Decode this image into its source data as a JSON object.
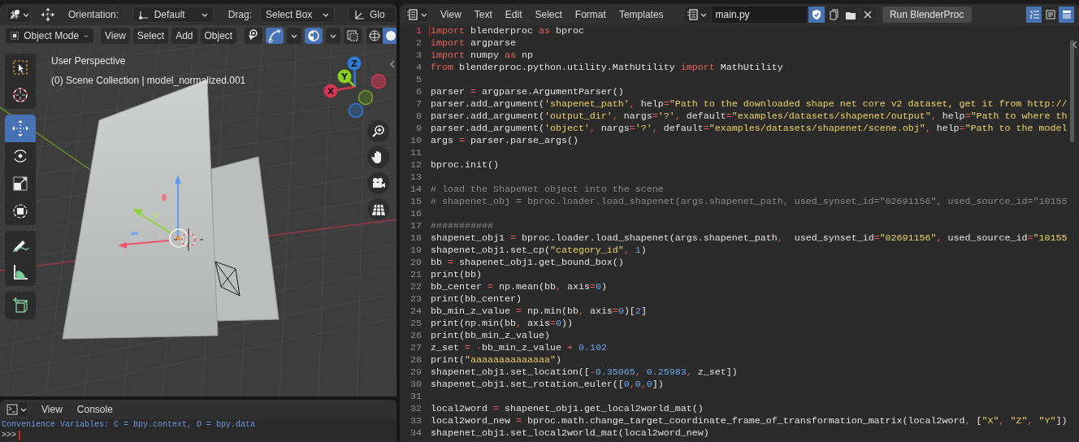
{
  "viewport": {
    "tool_header": {
      "orientation_label": "Orientation:",
      "orientation": "Default",
      "drag_label": "Drag:",
      "drag": "Select Box",
      "pivot": "Glo"
    },
    "mode": "Object Mode",
    "menus": [
      "View",
      "Select",
      "Add",
      "Object"
    ],
    "toggles": [
      {
        "on": false
      },
      {
        "on": true
      },
      {
        "on": true
      },
      {
        "on": false
      }
    ],
    "shading": [
      {
        "selected": false
      },
      {
        "selected": true
      }
    ],
    "overlay_text": [
      "User Perspective",
      "(0) Scene Collection | model_normalized.001"
    ],
    "axes": [
      "Z",
      "Y",
      "X"
    ],
    "tool_groups": [
      {
        "tools": [
          {
            "selected": false
          },
          {
            "selected": false
          }
        ]
      },
      {
        "tools": [
          {
            "selected": true
          },
          {
            "selected": false
          },
          {
            "selected": false
          },
          {
            "selected": false
          }
        ]
      },
      {
        "tools": [
          {
            "selected": false
          },
          {
            "selected": false
          }
        ]
      },
      {
        "tools": [
          {
            "selected": false
          }
        ]
      }
    ]
  },
  "console": {
    "menus": [
      "View",
      "Console"
    ],
    "lines": [
      "Convenience Variables: C = bpy.context, D = bpy.data",
      ">>>"
    ]
  },
  "text_editor": {
    "menus": [
      "View",
      "Text",
      "Edit",
      "Select",
      "Format",
      "Templates"
    ],
    "file_name": "main.py",
    "fake_user": {
      "on": true
    },
    "run_button": "Run BlenderProc",
    "view_toggles": [
      {
        "on": true
      },
      {
        "on": false
      },
      {
        "on": true
      }
    ],
    "lines": [
      {
        "number": "1",
        "current": true,
        "segments": [
          {
            "kind": "keyword",
            "text": "import"
          },
          {
            "kind": "plain",
            "text": " blenderproc "
          },
          {
            "kind": "keyword",
            "text": "as"
          },
          {
            "kind": "plain",
            "text": " bproc"
          }
        ]
      },
      {
        "number": "2",
        "current": false,
        "segments": [
          {
            "kind": "keyword",
            "text": "import"
          },
          {
            "kind": "plain",
            "text": " argparse"
          }
        ]
      },
      {
        "number": "3",
        "current": false,
        "segments": [
          {
            "kind": "keyword",
            "text": "import"
          },
          {
            "kind": "plain",
            "text": " numpy "
          },
          {
            "kind": "keyword",
            "text": "as"
          },
          {
            "kind": "plain",
            "text": " np"
          }
        ]
      },
      {
        "number": "4",
        "current": false,
        "segments": [
          {
            "kind": "keyword",
            "text": "from"
          },
          {
            "kind": "plain",
            "text": " blenderproc.python.utility.MathUtility "
          },
          {
            "kind": "keyword",
            "text": "import"
          },
          {
            "kind": "plain",
            "text": " MathUtility"
          }
        ]
      },
      {
        "number": "5",
        "current": false
      },
      {
        "number": "6",
        "current": false,
        "segments": [
          {
            "kind": "plain",
            "text": "parser "
          },
          {
            "kind": "operator",
            "text": "="
          },
          {
            "kind": "plain",
            "text": " argparse.ArgumentParser()"
          }
        ]
      },
      {
        "number": "7",
        "current": false,
        "segments": [
          {
            "kind": "plain",
            "text": "parser.add_argument("
          },
          {
            "kind": "string",
            "text": "'shapenet_path'"
          },
          {
            "kind": "operator",
            "text": ","
          },
          {
            "kind": "plain",
            "text": " help"
          },
          {
            "kind": "operator",
            "text": "="
          },
          {
            "kind": "string",
            "text": "\"Path to the downloaded shape net core v2 dataset, get it from http://"
          }
        ]
      },
      {
        "number": "8",
        "current": false,
        "segments": [
          {
            "kind": "plain",
            "text": "parser.add_argument("
          },
          {
            "kind": "string",
            "text": "'output_dir'"
          },
          {
            "kind": "operator",
            "text": ","
          },
          {
            "kind": "plain",
            "text": " nargs"
          },
          {
            "kind": "operator",
            "text": "="
          },
          {
            "kind": "string",
            "text": "'?'"
          },
          {
            "kind": "operator",
            "text": ","
          },
          {
            "kind": "plain",
            "text": " default"
          },
          {
            "kind": "operator",
            "text": "="
          },
          {
            "kind": "string",
            "text": "\"examples/datasets/shapenet/output\""
          },
          {
            "kind": "operator",
            "text": ","
          },
          {
            "kind": "plain",
            "text": " help"
          },
          {
            "kind": "operator",
            "text": "="
          },
          {
            "kind": "string",
            "text": "\"Path to where th"
          }
        ]
      },
      {
        "number": "9",
        "current": false,
        "segments": [
          {
            "kind": "plain",
            "text": "parser.add_argument("
          },
          {
            "kind": "string",
            "text": "'object'"
          },
          {
            "kind": "operator",
            "text": ","
          },
          {
            "kind": "plain",
            "text": " nargs"
          },
          {
            "kind": "operator",
            "text": "="
          },
          {
            "kind": "string",
            "text": "'?'"
          },
          {
            "kind": "operator",
            "text": ","
          },
          {
            "kind": "plain",
            "text": " default"
          },
          {
            "kind": "operator",
            "text": "="
          },
          {
            "kind": "string",
            "text": "\"examples/datasets/shapenet/scene.obj\""
          },
          {
            "kind": "operator",
            "text": ","
          },
          {
            "kind": "plain",
            "text": " help"
          },
          {
            "kind": "operator",
            "text": "="
          },
          {
            "kind": "string",
            "text": "\"Path to the model"
          }
        ]
      },
      {
        "number": "10",
        "current": false,
        "segments": [
          {
            "kind": "plain",
            "text": "args "
          },
          {
            "kind": "operator",
            "text": "="
          },
          {
            "kind": "plain",
            "text": " parser.parse_args()"
          }
        ]
      },
      {
        "number": "11",
        "current": false
      },
      {
        "number": "12",
        "current": false,
        "segments": [
          {
            "kind": "plain",
            "text": "bproc.init()"
          }
        ]
      },
      {
        "number": "13",
        "current": false
      },
      {
        "number": "14",
        "current": false,
        "segments": [
          {
            "kind": "comment",
            "text": "# load the ShapeNet object into the scene"
          }
        ]
      },
      {
        "number": "15",
        "current": false,
        "segments": [
          {
            "kind": "comment",
            "text": "# shapenet_obj = bproc.loader.load_shapenet(args.shapenet_path, used_synset_id=\"02691156\", used_source_id=\"10155"
          }
        ]
      },
      {
        "number": "16",
        "current": false
      },
      {
        "number": "17",
        "current": false,
        "segments": [
          {
            "kind": "comment",
            "text": "###########"
          }
        ]
      },
      {
        "number": "18",
        "current": false,
        "segments": [
          {
            "kind": "plain",
            "text": "shapenet_obj1 "
          },
          {
            "kind": "operator",
            "text": "="
          },
          {
            "kind": "plain",
            "text": " bproc.loader.load_shapenet(args.shapenet_path"
          },
          {
            "kind": "operator",
            "text": ","
          },
          {
            "kind": "plain",
            "text": "  used_synset_id"
          },
          {
            "kind": "operator",
            "text": "="
          },
          {
            "kind": "string",
            "text": "\"02691156\""
          },
          {
            "kind": "operator",
            "text": ","
          },
          {
            "kind": "plain",
            "text": " used_source_id"
          },
          {
            "kind": "operator",
            "text": "="
          },
          {
            "kind": "string",
            "text": "\"10155"
          }
        ]
      },
      {
        "number": "19",
        "current": false,
        "segments": [
          {
            "kind": "plain",
            "text": "shapenet_obj1.set_cp("
          },
          {
            "kind": "string",
            "text": "\"category_id\""
          },
          {
            "kind": "operator",
            "text": ", "
          },
          {
            "kind": "number",
            "text": "1"
          },
          {
            "kind": "plain",
            "text": ")"
          }
        ]
      },
      {
        "number": "20",
        "current": false,
        "segments": [
          {
            "kind": "plain",
            "text": "bb "
          },
          {
            "kind": "operator",
            "text": "="
          },
          {
            "kind": "plain",
            "text": " shapenet_obj1.get_bound_box()"
          }
        ]
      },
      {
        "number": "21",
        "current": false,
        "segments": [
          {
            "kind": "plain",
            "text": "print(bb)"
          }
        ]
      },
      {
        "number": "22",
        "current": false,
        "segments": [
          {
            "kind": "plain",
            "text": "bb_center "
          },
          {
            "kind": "operator",
            "text": "="
          },
          {
            "kind": "plain",
            "text": " np.mean(bb"
          },
          {
            "kind": "operator",
            "text": ","
          },
          {
            "kind": "plain",
            "text": " axis"
          },
          {
            "kind": "operator",
            "text": "="
          },
          {
            "kind": "number",
            "text": "0"
          },
          {
            "kind": "plain",
            "text": ")"
          }
        ]
      },
      {
        "number": "23",
        "current": false,
        "segments": [
          {
            "kind": "plain",
            "text": "print(bb_center)"
          }
        ]
      },
      {
        "number": "24",
        "current": false,
        "segments": [
          {
            "kind": "plain",
            "text": "bb_min_z_value "
          },
          {
            "kind": "operator",
            "text": "="
          },
          {
            "kind": "plain",
            "text": " np.min(bb"
          },
          {
            "kind": "operator",
            "text": ","
          },
          {
            "kind": "plain",
            "text": " axis"
          },
          {
            "kind": "operator",
            "text": "="
          },
          {
            "kind": "number",
            "text": "0"
          },
          {
            "kind": "plain",
            "text": ")["
          },
          {
            "kind": "number",
            "text": "2"
          },
          {
            "kind": "plain",
            "text": "]"
          }
        ]
      },
      {
        "number": "25",
        "current": false,
        "segments": [
          {
            "kind": "plain",
            "text": "print(np.min(bb"
          },
          {
            "kind": "operator",
            "text": ","
          },
          {
            "kind": "plain",
            "text": " axis"
          },
          {
            "kind": "operator",
            "text": "="
          },
          {
            "kind": "number",
            "text": "0"
          },
          {
            "kind": "plain",
            "text": "))"
          }
        ]
      },
      {
        "number": "26",
        "current": false,
        "segments": [
          {
            "kind": "plain",
            "text": "print(bb_min_z_value)"
          }
        ]
      },
      {
        "number": "27",
        "current": false,
        "segments": [
          {
            "kind": "plain",
            "text": "z_set "
          },
          {
            "kind": "operator",
            "text": "= -"
          },
          {
            "kind": "plain",
            "text": "bb_min_z_value "
          },
          {
            "kind": "operator",
            "text": "+ "
          },
          {
            "kind": "number",
            "text": "0.102"
          }
        ]
      },
      {
        "number": "28",
        "current": false,
        "segments": [
          {
            "kind": "plain",
            "text": "print("
          },
          {
            "kind": "string",
            "text": "\"aaaaaaaaaaaaaa\""
          },
          {
            "kind": "plain",
            "text": ")"
          }
        ]
      },
      {
        "number": "29",
        "current": false,
        "segments": [
          {
            "kind": "plain",
            "text": "shapenet_obj1.set_location(["
          },
          {
            "kind": "operator",
            "text": "-"
          },
          {
            "kind": "number",
            "text": "0.35065"
          },
          {
            "kind": "operator",
            "text": ", "
          },
          {
            "kind": "number",
            "text": "0.25983"
          },
          {
            "kind": "operator",
            "text": ","
          },
          {
            "kind": "plain",
            "text": " z_set])"
          }
        ]
      },
      {
        "number": "30",
        "current": false,
        "segments": [
          {
            "kind": "plain",
            "text": "shapenet_obj1.set_rotation_euler(["
          },
          {
            "kind": "number",
            "text": "0"
          },
          {
            "kind": "operator",
            "text": ","
          },
          {
            "kind": "number",
            "text": "0"
          },
          {
            "kind": "operator",
            "text": ","
          },
          {
            "kind": "number",
            "text": "0"
          },
          {
            "kind": "plain",
            "text": "])"
          }
        ]
      },
      {
        "number": "31",
        "current": false
      },
      {
        "number": "32",
        "current": false,
        "segments": [
          {
            "kind": "plain",
            "text": "local2word "
          },
          {
            "kind": "operator",
            "text": "="
          },
          {
            "kind": "plain",
            "text": " shapenet_obj1.get_local2world_mat()"
          }
        ]
      },
      {
        "number": "33",
        "current": false,
        "segments": [
          {
            "kind": "plain",
            "text": "local2word_new "
          },
          {
            "kind": "operator",
            "text": "="
          },
          {
            "kind": "plain",
            "text": " bproc.math.change_target_coordinate_frame_of_transformation_matrix(local2word"
          },
          {
            "kind": "operator",
            "text": ","
          },
          {
            "kind": "plain",
            "text": " ["
          },
          {
            "kind": "string",
            "text": "\"X\""
          },
          {
            "kind": "operator",
            "text": ", "
          },
          {
            "kind": "string",
            "text": "\"Z\""
          },
          {
            "kind": "operator",
            "text": ", "
          },
          {
            "kind": "string",
            "text": "\"Y\""
          },
          {
            "kind": "plain",
            "text": "])"
          }
        ]
      },
      {
        "number": "34",
        "current": false,
        "segments": [
          {
            "kind": "plain",
            "text": "shapenet_obj1.set_local2world_mat(local2word_new)"
          }
        ]
      }
    ]
  }
}
